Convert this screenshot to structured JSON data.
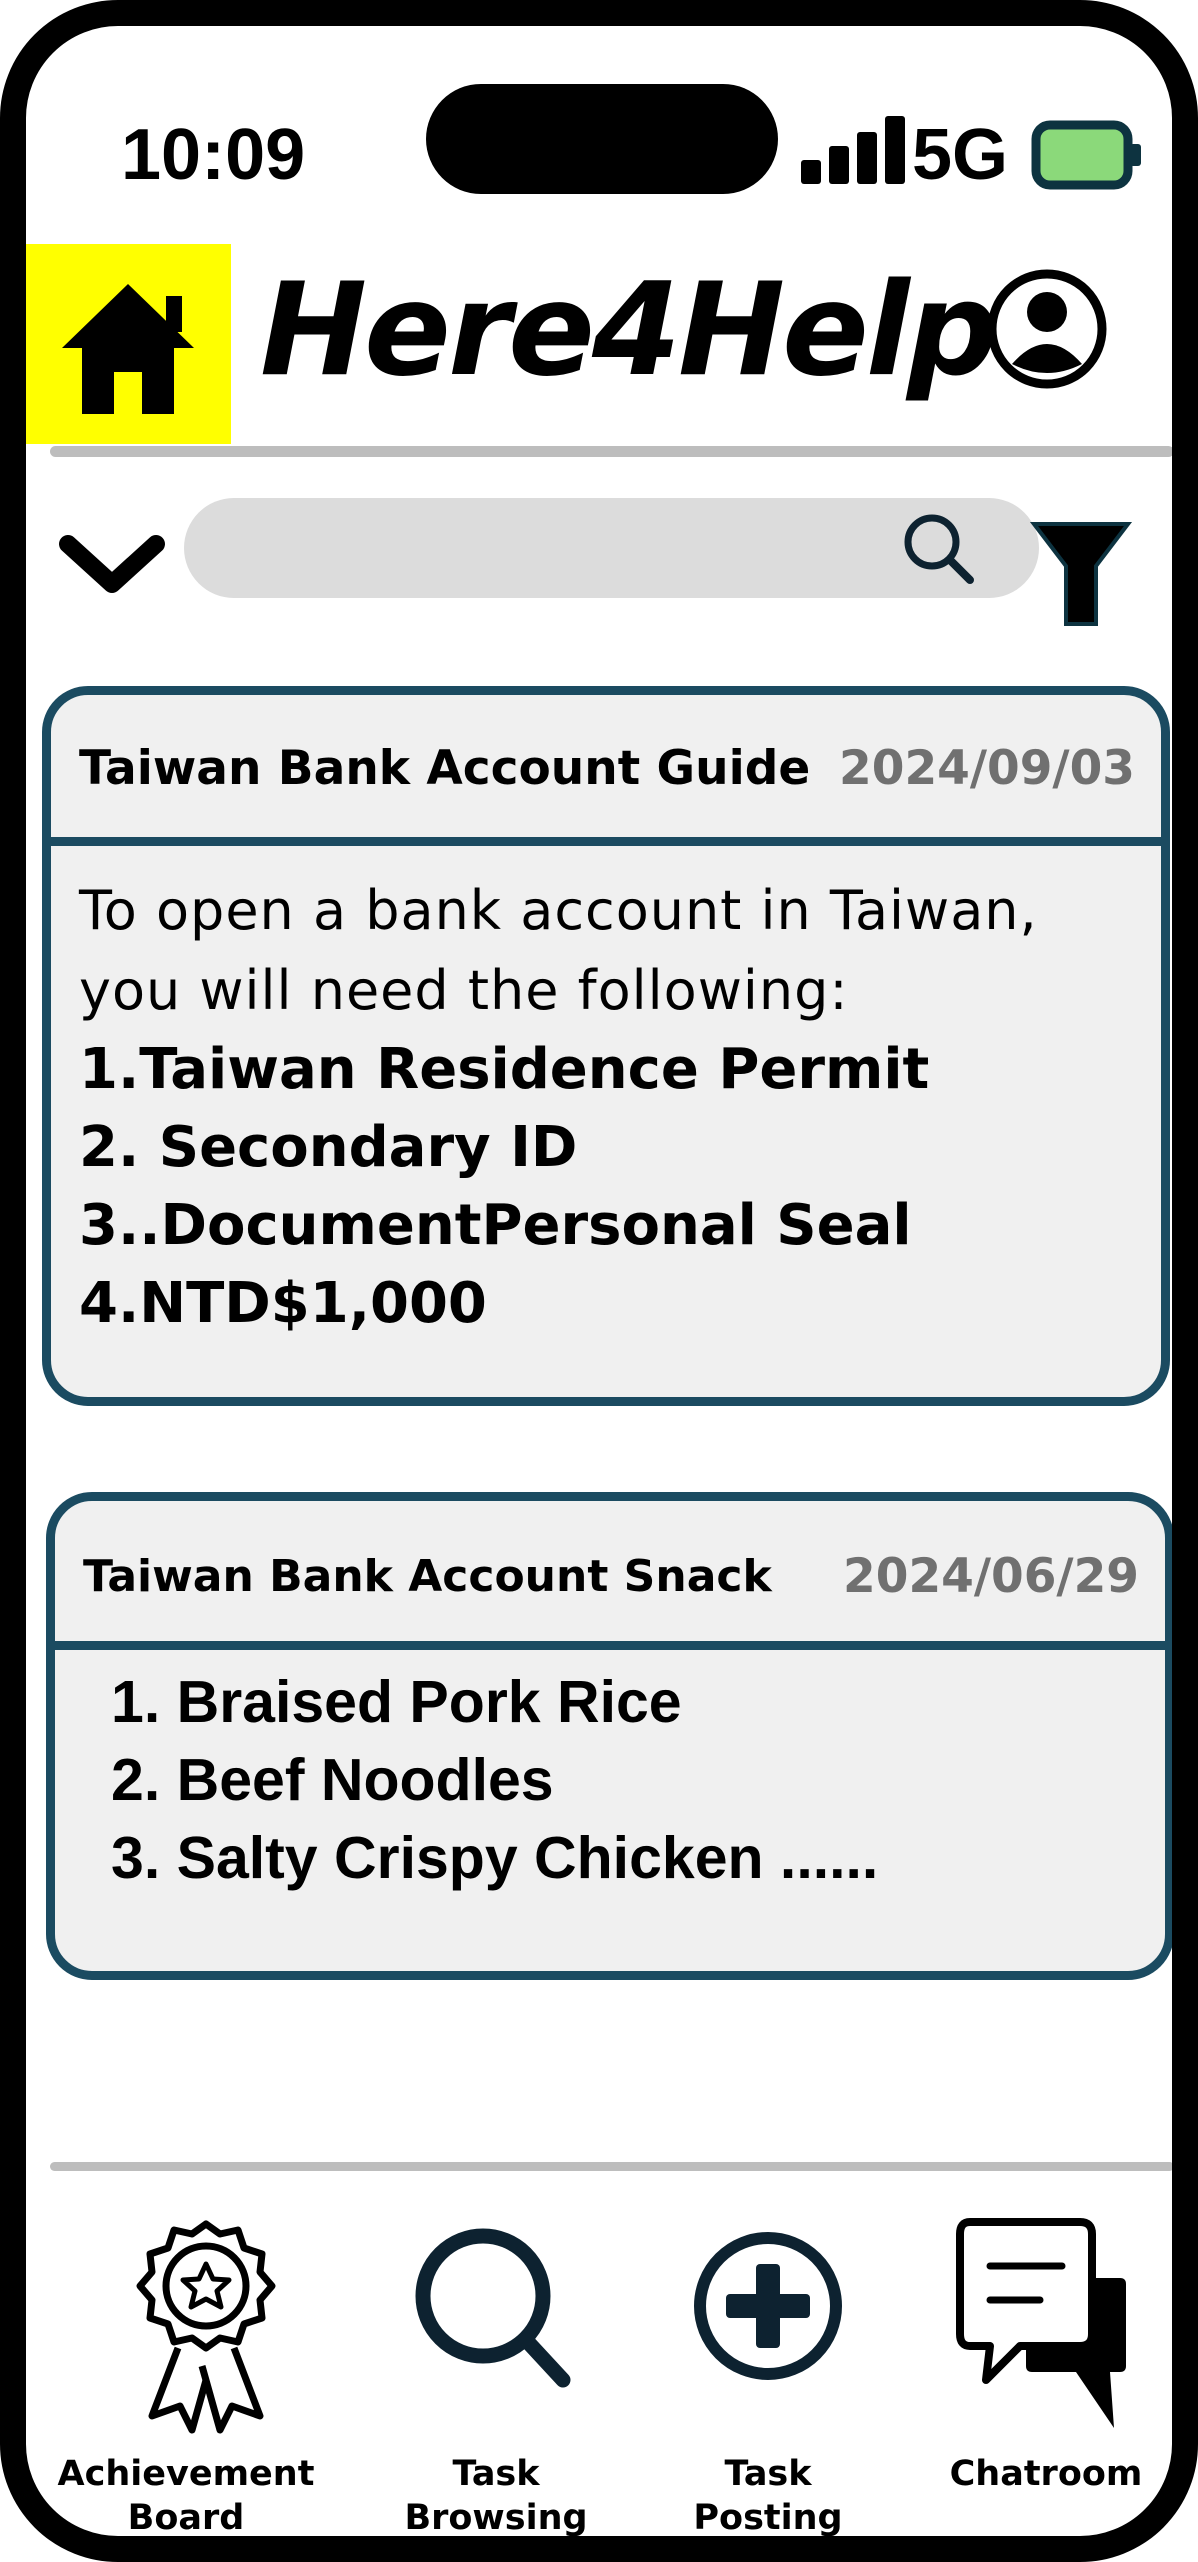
{
  "status_bar": {
    "time": "10:09",
    "network": "5G"
  },
  "header": {
    "app_title": "Here4Help"
  },
  "search": {
    "placeholder": ""
  },
  "cards": [
    {
      "title": "Taiwan Bank Account Guide",
      "date": "2024/09/03",
      "intro_lines": [
        "To open a bank account in Taiwan,",
        "you will need the following:"
      ],
      "items": [
        "1.Taiwan Residence Permit",
        "2. Secondary ID",
        "3..DocumentPersonal Seal",
        "4.NTD$1,000"
      ]
    },
    {
      "title": "Taiwan Bank Account Snack",
      "date": "2024/06/29",
      "items": [
        "1. Braised Pork Rice",
        "2. Beef Noodles",
        "3. Salty Crispy Chicken  ......"
      ]
    }
  ],
  "bottom_nav": [
    {
      "label_line1": "Achievement",
      "label_line2": "Board",
      "icon": "award-icon"
    },
    {
      "label_line1": "Task",
      "label_line2": "Browsing",
      "icon": "search-icon"
    },
    {
      "label_line1": "Task",
      "label_line2": "Posting",
      "icon": "plus-circle-icon"
    },
    {
      "label_line1": "Chatroom",
      "label_line2": "",
      "icon": "chat-icon"
    }
  ],
  "colors": {
    "highlight": "#ffff00",
    "card_border": "#1b4b61",
    "card_bg": "#f0f0f0",
    "date_text": "#707070",
    "battery": "#8bd97a"
  }
}
